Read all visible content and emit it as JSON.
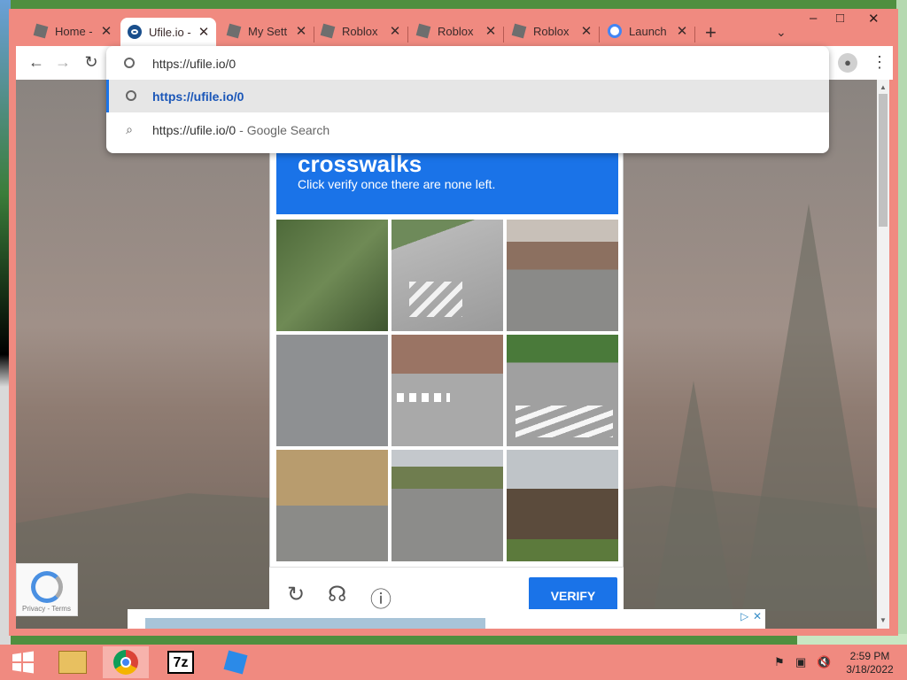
{
  "tabs": [
    {
      "title": "Home -",
      "favicon": "roblox-icon"
    },
    {
      "title": "Ufile.io -",
      "favicon": "ufile-icon",
      "active": true
    },
    {
      "title": "My Sett",
      "favicon": "roblox-icon"
    },
    {
      "title": "Roblox",
      "favicon": "roblox-icon"
    },
    {
      "title": "Roblox",
      "favicon": "roblox-icon"
    },
    {
      "title": "Roblox",
      "favicon": "roblox-icon"
    },
    {
      "title": "Launch",
      "favicon": "google-icon"
    }
  ],
  "window_controls": {
    "minimize": "–",
    "maximize": "□",
    "close": "✕"
  },
  "omnibox": {
    "input": "https://ufile.io/0",
    "suggestions": [
      {
        "text": "https://ufile.io/0",
        "icon": "globe-icon"
      },
      {
        "text": "https://ufile.io/0",
        "suffix": "- Google Search",
        "icon": "search-icon"
      }
    ]
  },
  "captcha": {
    "title": "crosswalks",
    "instruction": "Click verify once there are none left.",
    "verify_label": "VERIFY",
    "tiles": [
      "trees-fence",
      "crosswalk-road",
      "street-construction",
      "pavement",
      "crosswalk-intersection",
      "crosswalk-motorcycles",
      "bridge-railing",
      "highway",
      "houses"
    ]
  },
  "recaptcha_badge": {
    "text": "Privacy - Terms"
  },
  "taskbar": {
    "items": [
      "file-explorer-icon",
      "chrome-icon",
      "7zip-icon",
      "roblox-studio-icon"
    ],
    "time": "2:59 PM",
    "date": "3/18/2022"
  },
  "colors": {
    "accent": "#1a73e8",
    "chrome_frame": "#f08a80"
  }
}
